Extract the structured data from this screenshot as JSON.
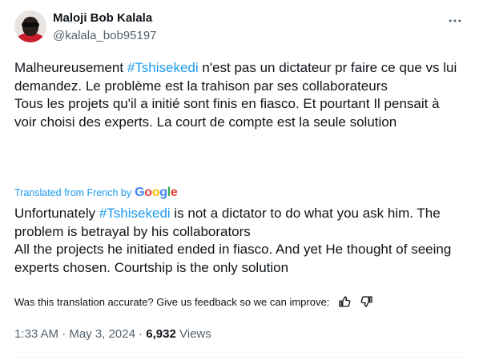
{
  "tweet": {
    "author_name": "Maloji Bob Kalala",
    "author_handle": "@kalala_bob95197",
    "more_icon": "more-icon",
    "original": {
      "pre_hashtag": "Malheureusement ",
      "hashtag": "#Tshisekedi",
      "post_hashtag": " n'est pas un dictateur pr faire ce que vs lui demandez. Le problème est la trahison par ses collaborateurs",
      "line2": "Tous les projets qu'il a initié sont finis en fiasco. Et pourtant Il pensait à voir choisi des experts. La court de compte est la seule solution"
    },
    "translated_label": "Translated from French by",
    "translation_provider": "Google",
    "translation": {
      "pre_hashtag": "Unfortunately ",
      "hashtag": "#Tshisekedi",
      "post_hashtag": " is not a dictator to do what you ask him. The problem is betrayal by his collaborators",
      "line2": "All the projects he initiated ended in fiasco. And yet He thought of seeing experts chosen. Courtship is the only solution"
    },
    "feedback_prompt": "Was this translation accurate? Give us feedback so we can improve:",
    "time": "1:33 AM",
    "separator": "·",
    "date": "May 3, 2024",
    "views_count": "6,932",
    "views_label": "Views"
  },
  "colors": {
    "accent": "#1d9bf0",
    "text": "#0f1419",
    "muted": "#536471"
  }
}
